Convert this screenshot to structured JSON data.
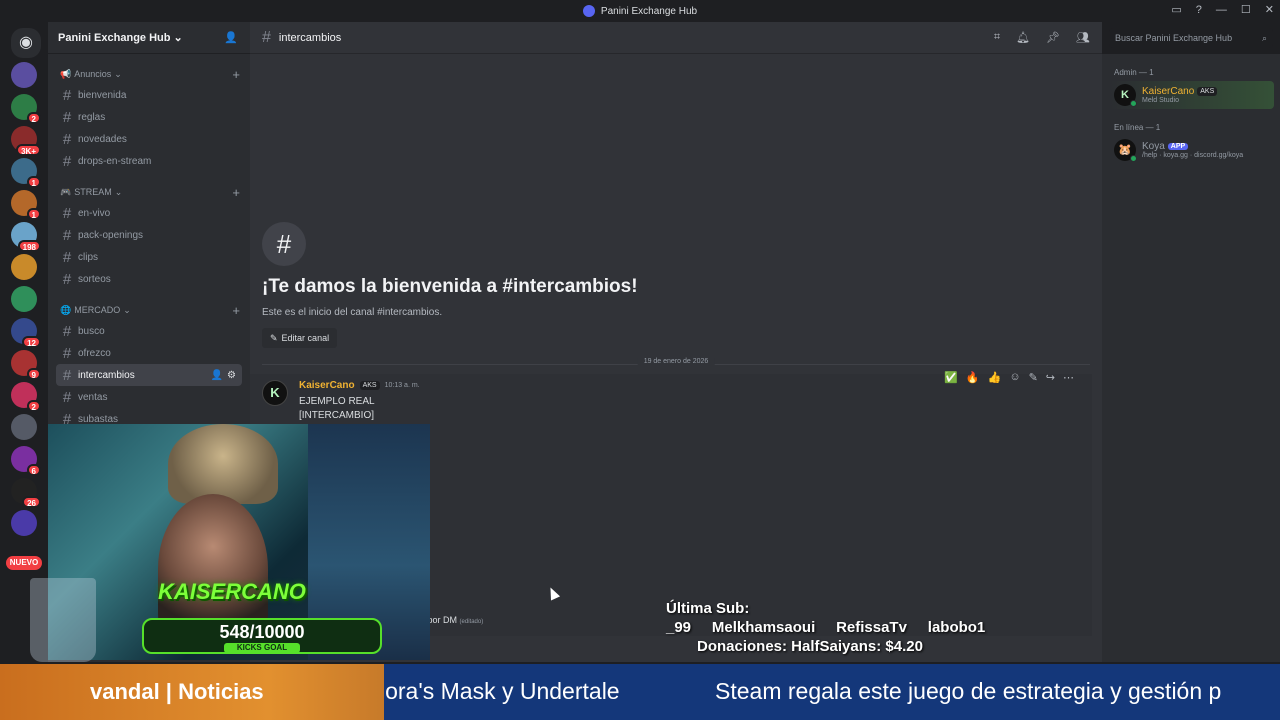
{
  "window": {
    "title": "Panini Exchange Hub"
  },
  "colors": {
    "accent": "#5865f2",
    "author": "#f0b232",
    "goal_green": "#56e02a",
    "ticker_bg": "#14377a",
    "ticker_label_bg": "#e2902f"
  },
  "server_list": {
    "home_icon": "discord-icon",
    "new_label": "NUEVO",
    "servers": [
      {
        "name": "server-1",
        "badge": ""
      },
      {
        "name": "server-2",
        "badge": "2"
      },
      {
        "name": "server-3",
        "badge": "3K+"
      },
      {
        "name": "server-4",
        "badge": "1"
      },
      {
        "name": "server-5",
        "badge": "1"
      },
      {
        "name": "server-6",
        "badge": "198"
      },
      {
        "name": "server-7",
        "badge": ""
      },
      {
        "name": "server-8",
        "badge": ""
      },
      {
        "name": "server-9",
        "badge": "12"
      },
      {
        "name": "server-10",
        "badge": "9"
      },
      {
        "name": "server-11",
        "badge": "2"
      },
      {
        "name": "server-12",
        "badge": ""
      },
      {
        "name": "server-13",
        "badge": "6"
      },
      {
        "name": "server-14",
        "badge": "26"
      },
      {
        "name": "server-15",
        "badge": ""
      }
    ]
  },
  "sidebar": {
    "guild_name": "Panini Exchange Hub",
    "categories": [
      {
        "name": "Anuncios",
        "channels": [
          "bienvenida",
          "reglas",
          "novedades",
          "drops-en-stream"
        ]
      },
      {
        "name": "STREAM",
        "channels": [
          "en-vivo",
          "pack-openings",
          "clips",
          "sorteos"
        ]
      },
      {
        "name": "MERCADO",
        "channels": [
          "busco",
          "ofrezco",
          "intercambios",
          "ventas",
          "subastas"
        ]
      }
    ],
    "active_channel": "intercambios"
  },
  "header": {
    "channel_name": "intercambios",
    "search_placeholder": "Buscar Panini Exchange Hub"
  },
  "welcome": {
    "title": "¡Te damos la bienvenida a #intercambios!",
    "subtitle": "Este es el inicio del canal #intercambios.",
    "edit_button": "Editar canal"
  },
  "messages": {
    "date_divider": "19 de enero de 2026",
    "author": "KaiserCano",
    "tag": "AKS",
    "time": "10:13 a. m.",
    "lines": [
      "EJEMPLO REAL",
      "[INTERCAMBIO]"
    ],
    "tail_text": "o por DM",
    "edited_label": "(editado)",
    "reactions": [
      "✅",
      "🔥",
      "👍"
    ]
  },
  "members": {
    "groups": [
      {
        "label": "Admin — 1",
        "members": [
          {
            "name": "KaiserCano",
            "tag": "AKS",
            "sub": "Meld Studio",
            "color": "#f0b232"
          }
        ]
      },
      {
        "label": "En línea — 1",
        "members": [
          {
            "name": "Koya",
            "tag": "APP",
            "sub": "/help · koya.gg · discord.gg/koya",
            "color": "#949ba4"
          }
        ]
      }
    ]
  },
  "stream_overlay": {
    "goal_name": "KAISERCANO",
    "goal_count": "548/10000",
    "goal_label": "KICKS GOAL",
    "last_sub_label": "Última Sub:",
    "subs_line": "_99     Melkhamsaoui     RefissaTv     labobo1",
    "donations": "Donaciones: HalfSaiyans: $4.20"
  },
  "ticker": {
    "label": "vandal | Noticias",
    "item1": "jora's Mask y Undertale",
    "item2": "Steam regala este juego de estrategia y gestión p"
  }
}
